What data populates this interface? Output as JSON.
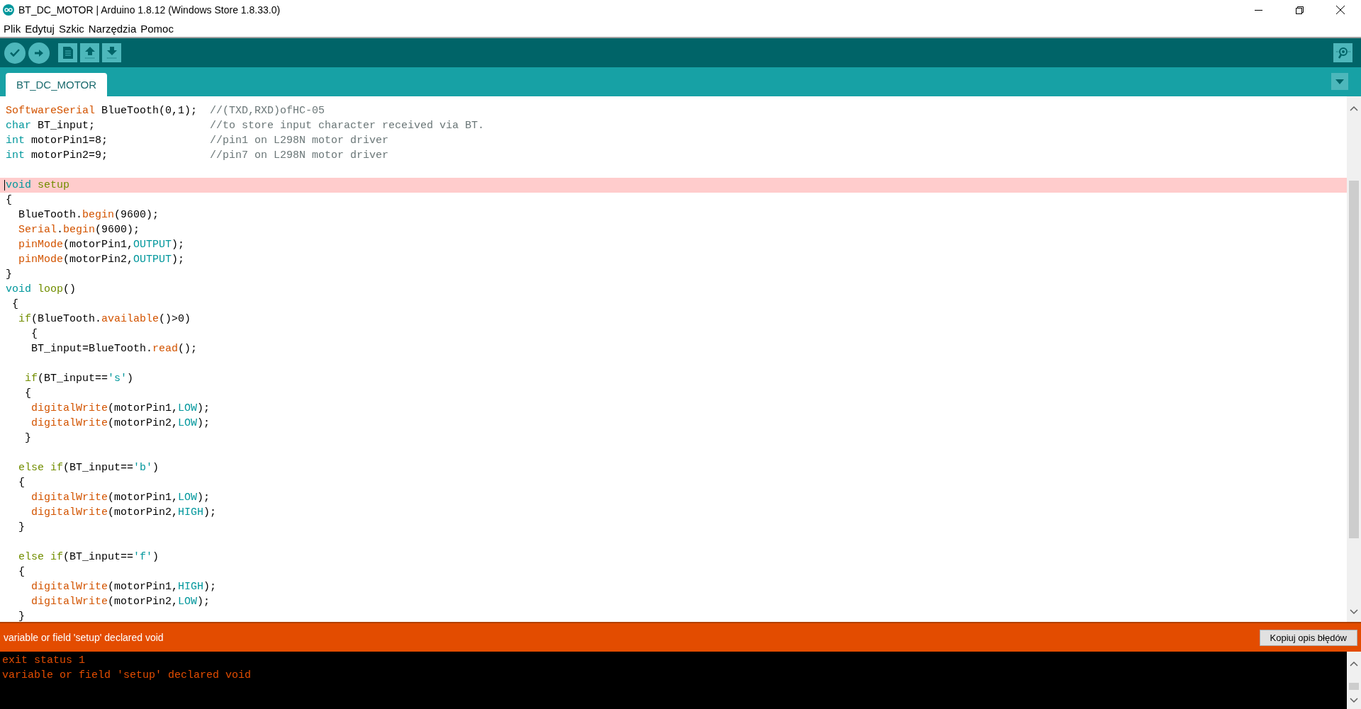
{
  "window": {
    "title": "BT_DC_MOTOR | Arduino 1.8.12 (Windows Store 1.8.33.0)"
  },
  "menu": [
    "Plik",
    "Edytuj",
    "Szkic",
    "Narzędzia",
    "Pomoc"
  ],
  "tabs": [
    {
      "label": "BT_DC_MOTOR",
      "selected": true
    }
  ],
  "editor": {
    "lines": [
      {
        "kind": "code",
        "highlighted": false,
        "tokens": [
          {
            "kind": "function",
            "text": "SoftwareSerial"
          },
          {
            "kind": "plain",
            "text": " BlueTooth(0,1);  "
          },
          {
            "kind": "comment",
            "text": "//(TXD,RXD)ofHC-05"
          }
        ]
      },
      {
        "kind": "code",
        "highlighted": false,
        "tokens": [
          {
            "kind": "type",
            "text": "char"
          },
          {
            "kind": "plain",
            "text": " BT_input;                  "
          },
          {
            "kind": "comment",
            "text": "//to store input character received via BT."
          }
        ]
      },
      {
        "kind": "code",
        "highlighted": false,
        "tokens": [
          {
            "kind": "type",
            "text": "int"
          },
          {
            "kind": "plain",
            "text": " motorPin1=8;                "
          },
          {
            "kind": "comment",
            "text": "//pin1 on L298N motor driver"
          }
        ]
      },
      {
        "kind": "code",
        "highlighted": false,
        "tokens": [
          {
            "kind": "type",
            "text": "int"
          },
          {
            "kind": "plain",
            "text": " motorPin2=9;                "
          },
          {
            "kind": "comment",
            "text": "//pin7 on L298N motor driver"
          }
        ]
      },
      {
        "kind": "blank",
        "highlighted": false
      },
      {
        "kind": "code",
        "highlighted": true,
        "tokens": [
          {
            "kind": "type",
            "text": "void "
          },
          {
            "kind": "keyword",
            "text": "setup"
          }
        ]
      },
      {
        "kind": "code",
        "highlighted": false,
        "tokens": [
          {
            "kind": "plain",
            "text": "{"
          }
        ]
      },
      {
        "kind": "code",
        "highlighted": false,
        "tokens": [
          {
            "kind": "plain",
            "text": "  BlueTooth."
          },
          {
            "kind": "function",
            "text": "begin"
          },
          {
            "kind": "plain",
            "text": "(9600);"
          }
        ]
      },
      {
        "kind": "code",
        "highlighted": false,
        "tokens": [
          {
            "kind": "function",
            "text": "  Serial"
          },
          {
            "kind": "plain",
            "text": "."
          },
          {
            "kind": "function",
            "text": "begin"
          },
          {
            "kind": "plain",
            "text": "(9600);"
          }
        ]
      },
      {
        "kind": "code",
        "highlighted": false,
        "tokens": [
          {
            "kind": "function",
            "text": "  pinMode"
          },
          {
            "kind": "plain",
            "text": "(motorPin1,"
          },
          {
            "kind": "constant",
            "text": "OUTPUT"
          },
          {
            "kind": "plain",
            "text": ");"
          }
        ]
      },
      {
        "kind": "code",
        "highlighted": false,
        "tokens": [
          {
            "kind": "function",
            "text": "  pinMode"
          },
          {
            "kind": "plain",
            "text": "(motorPin2,"
          },
          {
            "kind": "constant",
            "text": "OUTPUT"
          },
          {
            "kind": "plain",
            "text": ");"
          }
        ]
      },
      {
        "kind": "code",
        "highlighted": false,
        "tokens": [
          {
            "kind": "plain",
            "text": "}"
          }
        ]
      },
      {
        "kind": "code",
        "highlighted": false,
        "tokens": [
          {
            "kind": "type",
            "text": "void "
          },
          {
            "kind": "keyword",
            "text": "loop"
          },
          {
            "kind": "plain",
            "text": "()"
          }
        ]
      },
      {
        "kind": "code",
        "highlighted": false,
        "tokens": [
          {
            "kind": "plain",
            "text": " {"
          }
        ]
      },
      {
        "kind": "code",
        "highlighted": false,
        "tokens": [
          {
            "kind": "keyword",
            "text": "  if"
          },
          {
            "kind": "plain",
            "text": "(BlueTooth."
          },
          {
            "kind": "function",
            "text": "available"
          },
          {
            "kind": "plain",
            "text": "()>0)"
          }
        ]
      },
      {
        "kind": "code",
        "highlighted": false,
        "tokens": [
          {
            "kind": "plain",
            "text": "    {"
          }
        ]
      },
      {
        "kind": "code",
        "highlighted": false,
        "tokens": [
          {
            "kind": "plain",
            "text": "    BT_input=BlueTooth."
          },
          {
            "kind": "function",
            "text": "read"
          },
          {
            "kind": "plain",
            "text": "();"
          }
        ]
      },
      {
        "kind": "blank",
        "highlighted": false
      },
      {
        "kind": "code",
        "highlighted": false,
        "tokens": [
          {
            "kind": "keyword",
            "text": "   if"
          },
          {
            "kind": "plain",
            "text": "(BT_input=="
          },
          {
            "kind": "constant",
            "text": "'s'"
          },
          {
            "kind": "plain",
            "text": ")"
          }
        ]
      },
      {
        "kind": "code",
        "highlighted": false,
        "tokens": [
          {
            "kind": "plain",
            "text": "   {"
          }
        ]
      },
      {
        "kind": "code",
        "highlighted": false,
        "tokens": [
          {
            "kind": "function",
            "text": "    digitalWrite"
          },
          {
            "kind": "plain",
            "text": "(motorPin1,"
          },
          {
            "kind": "constant",
            "text": "LOW"
          },
          {
            "kind": "plain",
            "text": ");"
          }
        ]
      },
      {
        "kind": "code",
        "highlighted": false,
        "tokens": [
          {
            "kind": "function",
            "text": "    digitalWrite"
          },
          {
            "kind": "plain",
            "text": "(motorPin2,"
          },
          {
            "kind": "constant",
            "text": "LOW"
          },
          {
            "kind": "plain",
            "text": ");"
          }
        ]
      },
      {
        "kind": "code",
        "highlighted": false,
        "tokens": [
          {
            "kind": "plain",
            "text": "   }"
          }
        ]
      },
      {
        "kind": "blank",
        "highlighted": false
      },
      {
        "kind": "code",
        "highlighted": false,
        "tokens": [
          {
            "kind": "keyword",
            "text": "  else if"
          },
          {
            "kind": "plain",
            "text": "(BT_input=="
          },
          {
            "kind": "constant",
            "text": "'b'"
          },
          {
            "kind": "plain",
            "text": ")"
          }
        ]
      },
      {
        "kind": "code",
        "highlighted": false,
        "tokens": [
          {
            "kind": "plain",
            "text": "  {"
          }
        ]
      },
      {
        "kind": "code",
        "highlighted": false,
        "tokens": [
          {
            "kind": "function",
            "text": "    digitalWrite"
          },
          {
            "kind": "plain",
            "text": "(motorPin1,"
          },
          {
            "kind": "constant",
            "text": "LOW"
          },
          {
            "kind": "plain",
            "text": ");"
          }
        ]
      },
      {
        "kind": "code",
        "highlighted": false,
        "tokens": [
          {
            "kind": "function",
            "text": "    digitalWrite"
          },
          {
            "kind": "plain",
            "text": "(motorPin2,"
          },
          {
            "kind": "constant",
            "text": "HIGH"
          },
          {
            "kind": "plain",
            "text": ");"
          }
        ]
      },
      {
        "kind": "code",
        "highlighted": false,
        "tokens": [
          {
            "kind": "plain",
            "text": "  }"
          }
        ]
      },
      {
        "kind": "blank",
        "highlighted": false
      },
      {
        "kind": "code",
        "highlighted": false,
        "tokens": [
          {
            "kind": "keyword",
            "text": "  else if"
          },
          {
            "kind": "plain",
            "text": "(BT_input=="
          },
          {
            "kind": "constant",
            "text": "'f'"
          },
          {
            "kind": "plain",
            "text": ")"
          }
        ]
      },
      {
        "kind": "code",
        "highlighted": false,
        "tokens": [
          {
            "kind": "plain",
            "text": "  {"
          }
        ]
      },
      {
        "kind": "code",
        "highlighted": false,
        "tokens": [
          {
            "kind": "function",
            "text": "    digitalWrite"
          },
          {
            "kind": "plain",
            "text": "(motorPin1,"
          },
          {
            "kind": "constant",
            "text": "HIGH"
          },
          {
            "kind": "plain",
            "text": ");"
          }
        ]
      },
      {
        "kind": "code",
        "highlighted": false,
        "tokens": [
          {
            "kind": "function",
            "text": "    digitalWrite"
          },
          {
            "kind": "plain",
            "text": "(motorPin2,"
          },
          {
            "kind": "constant",
            "text": "LOW"
          },
          {
            "kind": "plain",
            "text": ");"
          }
        ]
      },
      {
        "kind": "code",
        "highlighted": false,
        "tokens": [
          {
            "kind": "plain",
            "text": "  }"
          }
        ]
      }
    ]
  },
  "error_bar": {
    "message": "variable or field 'setup' declared void",
    "button": "Kopiuj opis błędów"
  },
  "console": {
    "lines": [
      "exit status 1",
      "variable or field 'setup' declared void"
    ]
  }
}
